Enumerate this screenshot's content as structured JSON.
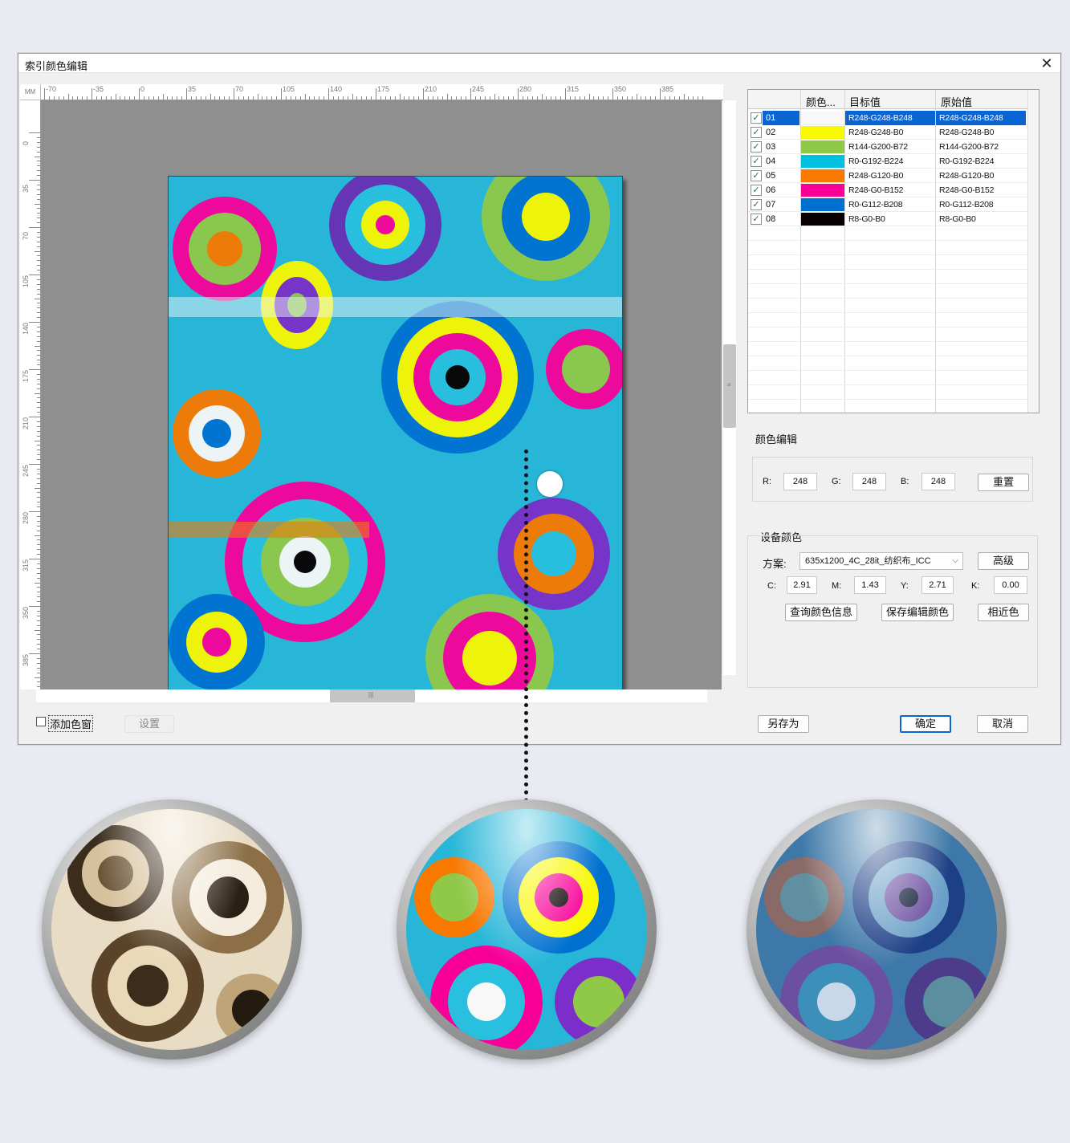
{
  "window": {
    "title": "索引颜色编辑",
    "close_glyph": "✕"
  },
  "rulers": {
    "unit": "MM",
    "top_ticks": [
      "-70",
      "-35",
      "0",
      "35",
      "70",
      "105",
      "140",
      "175",
      "210",
      "245",
      "280",
      "315",
      "350",
      "385"
    ],
    "left_ticks": [
      "0",
      "35",
      "70",
      "105",
      "140",
      "175",
      "210",
      "245",
      "280",
      "315",
      "350",
      "385"
    ]
  },
  "table": {
    "headers": [
      "颜色...",
      "目标值",
      "原始值"
    ],
    "rows": [
      {
        "id": "01",
        "swatch": "#f8f8f8",
        "target": "R248-G248-B248",
        "original": "R248-G248-B248",
        "checked": true,
        "selected": true
      },
      {
        "id": "02",
        "swatch": "#f8f800",
        "target": "R248-G248-B0",
        "original": "R248-G248-B0",
        "checked": true
      },
      {
        "id": "03",
        "swatch": "#90c848",
        "target": "R144-G200-B72",
        "original": "R144-G200-B72",
        "checked": true
      },
      {
        "id": "04",
        "swatch": "#00c0e0",
        "target": "R0-G192-B224",
        "original": "R0-G192-B224",
        "checked": true
      },
      {
        "id": "05",
        "swatch": "#f87800",
        "target": "R248-G120-B0",
        "original": "R248-G120-B0",
        "checked": true
      },
      {
        "id": "06",
        "swatch": "#f80098",
        "target": "R248-G0-B152",
        "original": "R248-G0-B152",
        "checked": true
      },
      {
        "id": "07",
        "swatch": "#0070d0",
        "target": "R0-G112-B208",
        "original": "R0-G112-B208",
        "checked": true
      },
      {
        "id": "08",
        "swatch": "#080000",
        "target": "R8-G0-B0",
        "original": "R8-G0-B0",
        "checked": true
      }
    ]
  },
  "color_edit": {
    "title": "颜色编辑",
    "r_label": "R:",
    "r_value": "248",
    "g_label": "G:",
    "g_value": "248",
    "b_label": "B:",
    "b_value": "248",
    "reset_label": "重置"
  },
  "device_color": {
    "title": "设备颜色",
    "scheme_label": "方案:",
    "scheme_value": "635x1200_4C_28it_纺织布_ICC",
    "advanced_label": "高级",
    "c_label": "C:",
    "c_value": "2.91",
    "m_label": "M:",
    "m_value": "1.43",
    "y_label": "Y:",
    "y_value": "2.71",
    "k_label": "K:",
    "k_value": "0.00",
    "query_label": "查询颜色信息",
    "save_label": "保存编辑颜色",
    "similar_label": "相近色"
  },
  "footer": {
    "add_window_label": "添加色窗",
    "settings_label": "设置",
    "save_as_label": "另存为",
    "ok_label": "确定",
    "cancel_label": "取消"
  },
  "colors": {
    "selection": "#0a64d2",
    "workspace": "#8f8f8f"
  }
}
